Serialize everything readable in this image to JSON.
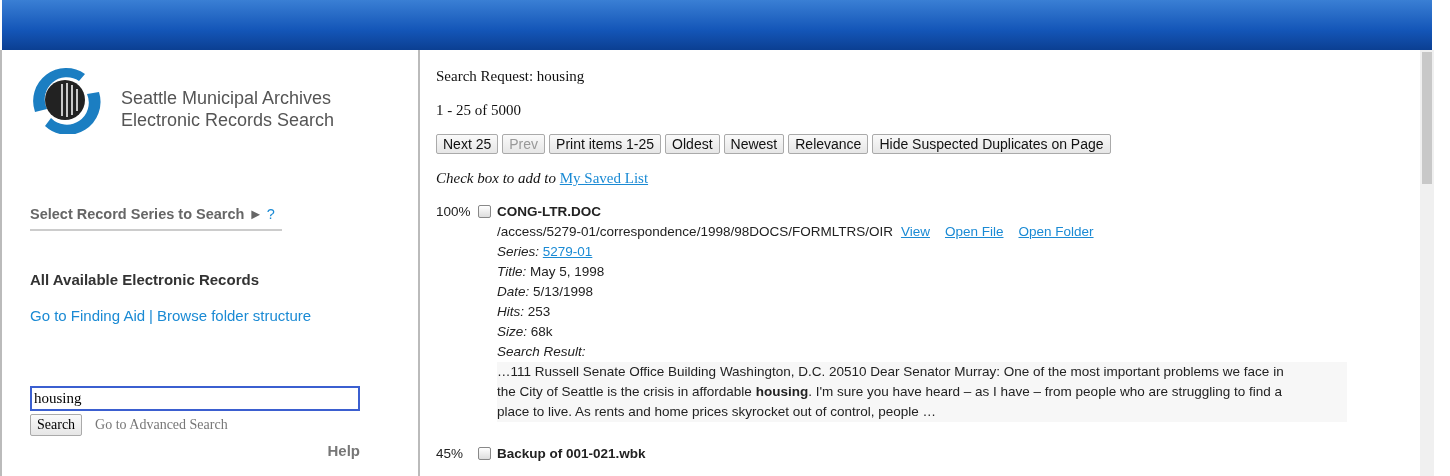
{
  "sidebar": {
    "title_lines": [
      "Seattle Municipal Archives",
      "Electronic Records Search"
    ],
    "series_selector": {
      "label": "Select Record Series to Search ►",
      "help": "?"
    },
    "scope": "All Available Electronic Records",
    "links": [
      {
        "label": "Go to Finding Aid"
      },
      {
        "label": "Browse folder structure"
      }
    ],
    "link_separator": "|",
    "search": {
      "value": "housing",
      "button": "Search",
      "advanced": "Go to Advanced Search"
    },
    "help": "Help"
  },
  "results": {
    "request": "Search Request: housing",
    "count": "1 - 25 of 5000",
    "buttons": [
      {
        "label": "Next 25",
        "disabled": false
      },
      {
        "label": "Prev",
        "disabled": true
      },
      {
        "label": "Print items 1-25",
        "disabled": false
      },
      {
        "label": "Oldest",
        "disabled": false
      },
      {
        "label": "Newest",
        "disabled": false
      },
      {
        "label": "Relevance",
        "disabled": false
      },
      {
        "label": "Hide Suspected Duplicates on Page",
        "disabled": false
      }
    ],
    "saved_hint": "Check box to add to",
    "saved_link": "My Saved List",
    "items": [
      {
        "score": "100%",
        "checked": false,
        "title": "CONG-LTR.DOC",
        "path": "/access/5279-01/correspondence/1998/98DOCS/FORMLTRS/OIR",
        "actions": [
          "View",
          "Open File",
          "Open Folder"
        ],
        "fields": [
          {
            "label": "Series:",
            "value": "5279-01",
            "kind": "link"
          },
          {
            "label": "Title:",
            "value": "May 5, 1998",
            "kind": "text"
          },
          {
            "label": "Date:",
            "value": "5/13/1998",
            "kind": "text"
          },
          {
            "label": "Hits:",
            "value": "253",
            "kind": "text"
          },
          {
            "label": "Size:",
            "value": "68k",
            "kind": "text"
          }
        ],
        "snippet_label": "Search Result:",
        "snippet": "…111 Russell Senate Office Building Washington, D.C. 20510 Dear Senator Murray: One of the most important problems we face in the City of Seattle is the crisis in affordable **housing**. I'm sure you have heard – as I have – from people who are struggling to find a place to live. As rents and home prices skyrocket out of control, people …"
      },
      {
        "score": "45%",
        "checked": false,
        "title": "Backup of 001-021.wbk"
      }
    ]
  }
}
